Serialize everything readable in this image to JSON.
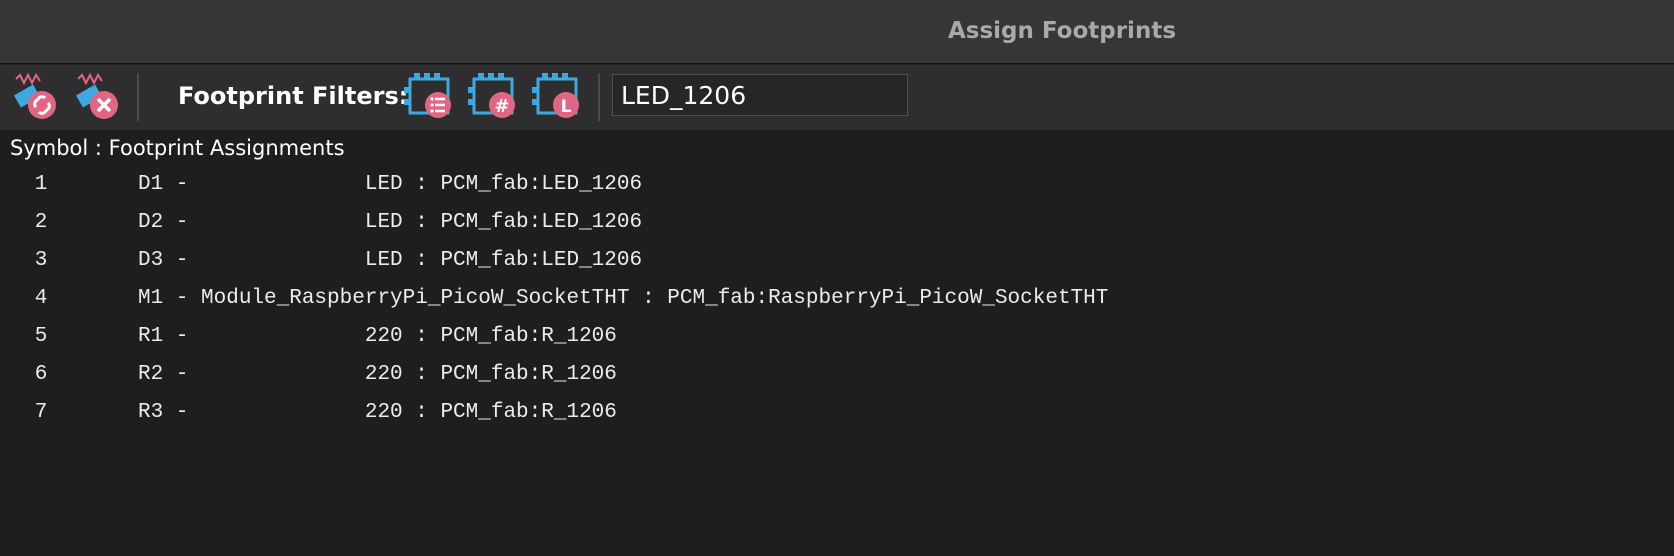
{
  "window": {
    "title": "Assign Footprints"
  },
  "toolbar": {
    "associate_icon": "associate-footprint-icon",
    "delete_icon": "delete-association-icon",
    "filters_label": "Footprint Filters:",
    "filter_keywords_icon": "filter-keywords-icon",
    "filter_pincount_icon": "filter-pin-count-icon",
    "filter_library_icon": "filter-library-icon",
    "filter_text": "LED_1206",
    "accent_blue": "#3ea9e0",
    "accent_pink": "#e36584"
  },
  "assignments": {
    "header": "Symbol : Footprint Assignments",
    "rows": [
      {
        "num": "1",
        "line": "D1 -              LED : PCM_fab:LED_1206"
      },
      {
        "num": "2",
        "line": "D2 -              LED : PCM_fab:LED_1206"
      },
      {
        "num": "3",
        "line": "D3 -              LED : PCM_fab:LED_1206"
      },
      {
        "num": "4",
        "line": "M1 - Module_RaspberryPi_PicoW_SocketTHT : PCM_fab:RaspberryPi_PicoW_SocketTHT"
      },
      {
        "num": "5",
        "line": "R1 -              220 : PCM_fab:R_1206"
      },
      {
        "num": "6",
        "line": "R2 -              220 : PCM_fab:R_1206"
      },
      {
        "num": "7",
        "line": "R3 -              220 : PCM_fab:R_1206"
      }
    ]
  }
}
